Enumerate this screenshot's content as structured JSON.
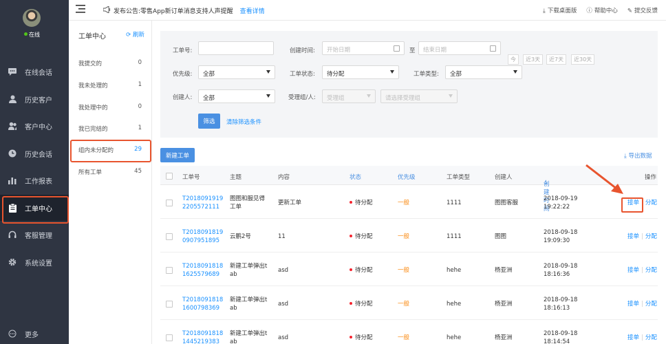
{
  "sidebar": {
    "status": "在线",
    "items": [
      {
        "label": "在线会话",
        "icon": "chat-icon"
      },
      {
        "label": "历史客户",
        "icon": "user-icon"
      },
      {
        "label": "客户中心",
        "icon": "users-icon"
      },
      {
        "label": "历史会话",
        "icon": "clock-icon"
      },
      {
        "label": "工作报表",
        "icon": "bar-chart-icon"
      },
      {
        "label": "工单中心",
        "icon": "clipboard-icon"
      },
      {
        "label": "客服管理",
        "icon": "headset-icon"
      },
      {
        "label": "系统设置",
        "icon": "gear-icon"
      }
    ],
    "more": "更多"
  },
  "topbar": {
    "notice_prefix": "发布公告:",
    "notice_text": "零售App新订单消息支持人声提醒",
    "notice_link": "查看详情",
    "download": "下载桌面版",
    "help": "帮助中心",
    "feedback": "提交反馈"
  },
  "left_panel": {
    "title": "工单中心",
    "refresh": "刷新",
    "items": [
      {
        "label": "我提交的",
        "count": "0"
      },
      {
        "label": "我未处理的",
        "count": "1"
      },
      {
        "label": "我处理中的",
        "count": "0"
      },
      {
        "label": "我已完结的",
        "count": "1"
      },
      {
        "label": "组内未分配的",
        "count": "29"
      },
      {
        "label": "所有工单",
        "count": "45"
      }
    ]
  },
  "filter": {
    "ticket_no_label": "工单号:",
    "created_time_label": "创建时间:",
    "start_placeholder": "开始日期",
    "to": "至",
    "end_placeholder": "结束日期",
    "quick": [
      "今",
      "近3天",
      "近7天",
      "近30天"
    ],
    "priority_label": "优先级:",
    "priority_value": "全部",
    "status_label": "工单状态:",
    "status_value": "待分配",
    "type_label": "工单类型:",
    "type_value": "全部",
    "creator_label": "创建人:",
    "creator_value": "全部",
    "group_label": "受理组/人:",
    "group_placeholder": "受理组",
    "person_placeholder": "请选择受理组",
    "filter_button": "筛选",
    "clear_link": "清除筛选条件"
  },
  "actions": {
    "new_ticket": "新建工单",
    "export": "导出数据"
  },
  "table": {
    "headers": [
      "工单号",
      "主题",
      "内容",
      "状态",
      "优先级",
      "工单类型",
      "创建人",
      "创建时间",
      "操作"
    ],
    "rows": [
      {
        "id1": "T2018091919",
        "id2": "2205572111",
        "subject1": "图图和服见得",
        "subject2": "工单",
        "content": "更新工单",
        "status": "待分配",
        "priority": "一般",
        "type": "1111",
        "creator": "图图客服",
        "date": "2018-09-19",
        "time": "19:22:22",
        "accept": "接单",
        "assign": "分配"
      },
      {
        "id1": "T2018091819",
        "id2": "0907951895",
        "subject1": "云鹏2号",
        "subject2": "",
        "content": "11",
        "status": "待分配",
        "priority": "一般",
        "type": "1111",
        "creator": "图图",
        "date": "2018-09-18",
        "time": "19:09:30",
        "accept": "接单",
        "assign": "分配"
      },
      {
        "id1": "T2018091818",
        "id2": "1625579689",
        "subject1": "新建工单弹出t",
        "subject2": "ab",
        "content": "asd",
        "status": "待分配",
        "priority": "一般",
        "type": "hehe",
        "creator": "杨亚洲",
        "date": "2018-09-18",
        "time": "18:16:36",
        "accept": "接单",
        "assign": "分配"
      },
      {
        "id1": "T2018091818",
        "id2": "1600798369",
        "subject1": "新建工单弹出t",
        "subject2": "ab",
        "content": "asd",
        "status": "待分配",
        "priority": "一般",
        "type": "hehe",
        "creator": "杨亚洲",
        "date": "2018-09-18",
        "time": "18:16:13",
        "accept": "接单",
        "assign": "分配"
      },
      {
        "id1": "T2018091818",
        "id2": "1445219383",
        "subject1": "新建工单弹出t",
        "subject2": "ab",
        "content": "asd",
        "status": "待分配",
        "priority": "一般",
        "type": "hehe",
        "creator": "杨亚洲",
        "date": "2018-09-18",
        "time": "18:14:54",
        "accept": "接单",
        "assign": "分配"
      }
    ]
  },
  "colors": {
    "accent": "#1890ff",
    "highlight": "#e8542e",
    "sidebar": "#2f3542",
    "priority": "#fa8c16",
    "status_dot": "#f5222d"
  }
}
